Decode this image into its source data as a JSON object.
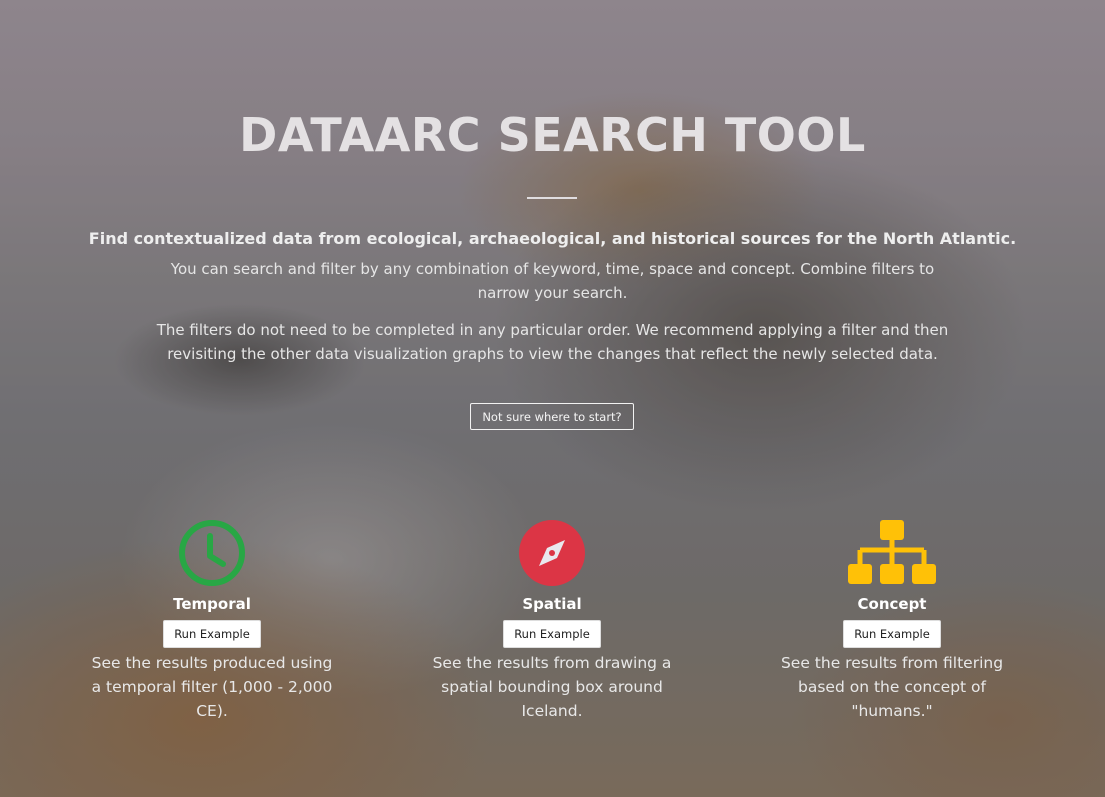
{
  "hero": {
    "title": "DATAARC SEARCH TOOL",
    "lead": "Find contextualized data from ecological, archaeological, and historical sources for the North Atlantic.",
    "para1": "You can search and filter by any combination of keyword, time, space and concept. Combine filters to narrow your search.",
    "para2": "The filters do not need to be completed in any particular order. We recommend applying a filter and then revisiting the other data visualization graphs to view the changes that reflect the newly selected data.",
    "start_button": "Not sure where to start?"
  },
  "features": [
    {
      "name": "Temporal",
      "button": "Run Example",
      "description": "See the results produced using a temporal filter (1,000 - 2,000 CE).",
      "icon": "clock-icon",
      "color": "#28a745"
    },
    {
      "name": "Spatial",
      "button": "Run Example",
      "description": "See the results from drawing a spatial bounding box around Iceland.",
      "icon": "compass-icon",
      "color": "#dc3545"
    },
    {
      "name": "Concept",
      "button": "Run Example",
      "description": "See the results from filtering based on the concept of \"humans.\"",
      "icon": "sitemap-icon",
      "color": "#ffc107"
    }
  ]
}
